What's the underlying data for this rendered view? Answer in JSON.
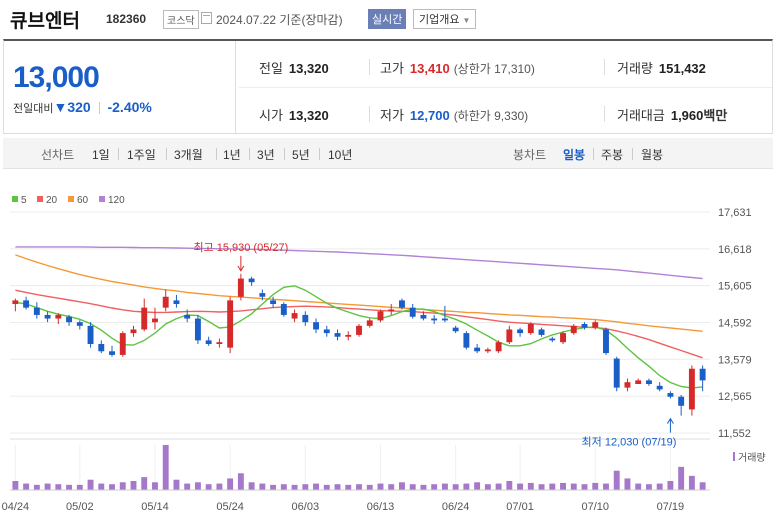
{
  "header": {
    "name": "큐브엔터",
    "code": "182360",
    "market": "코스닥",
    "date": "2024.07.22 기준(장마감)",
    "realtime": "실시간",
    "company_info": "기업개요"
  },
  "quote": {
    "price": "13,000",
    "change_label": "전일대비",
    "change": "320",
    "change_pct": "-2.40%",
    "prev_close": {
      "label": "전일",
      "value": "13,320"
    },
    "open": {
      "label": "시가",
      "value": "13,320"
    },
    "high": {
      "label": "고가",
      "value": "13,410",
      "limit_label": "(상한가 17,310)"
    },
    "low": {
      "label": "저가",
      "value": "12,700",
      "limit_label": "(하한가 9,330)"
    },
    "volume": {
      "label": "거래량",
      "value": "151,432"
    },
    "trading_value": {
      "label": "거래대금",
      "value": "1,960",
      "unit": "백만"
    }
  },
  "periods": {
    "line_label": "선차트",
    "line_items": [
      "1일",
      "1주일",
      "3개월",
      "1년",
      "3년",
      "5년",
      "10년"
    ],
    "candle_label": "봉차트",
    "candle_items": [
      "일봉",
      "주봉",
      "월봉"
    ],
    "candle_selected": "일봉"
  },
  "colors": {
    "up": "#d62a2a",
    "down": "#1a5ec8",
    "ma5": "#5cc43f",
    "ma20": "#f06060",
    "ma60": "#f39a36",
    "ma120": "#b083d6",
    "volume": "#a678c9"
  },
  "chart_data": {
    "type": "candlestick",
    "legend": [
      "5",
      "20",
      "60",
      "120"
    ],
    "y_ticks": [
      17631,
      16618,
      15605,
      14592,
      13579,
      12565,
      11552
    ],
    "ylim": [
      11552,
      17631
    ],
    "x_ticks": [
      "04/24",
      "05/02",
      "05/14",
      "05/24",
      "06/03",
      "06/13",
      "06/24",
      "07/01",
      "07/10",
      "07/19"
    ],
    "x_tick_index": [
      0,
      6,
      13,
      20,
      27,
      34,
      41,
      47,
      54,
      61
    ],
    "annotations": {
      "high": {
        "label": "최고 15,930 (05/27)",
        "index": 21,
        "value": 15930
      },
      "low": {
        "label": "최저 12,030 (07/19)",
        "index": 61,
        "value": 12030
      }
    },
    "volume_label": "거래량",
    "candles": [
      [
        15100,
        15250,
        14900,
        15200
      ],
      [
        15200,
        15300,
        14950,
        15000
      ],
      [
        15000,
        15150,
        14700,
        14800
      ],
      [
        14800,
        14900,
        14600,
        14700
      ],
      [
        14700,
        14850,
        14550,
        14800
      ],
      [
        14750,
        14800,
        14500,
        14600
      ],
      [
        14600,
        14650,
        14400,
        14500
      ],
      [
        14500,
        14600,
        13900,
        14000
      ],
      [
        14000,
        14100,
        13750,
        13800
      ],
      [
        13800,
        13950,
        13650,
        13700
      ],
      [
        13700,
        14350,
        13650,
        14300
      ],
      [
        14300,
        14500,
        14200,
        14400
      ],
      [
        14400,
        15250,
        14350,
        15000
      ],
      [
        14600,
        15000,
        14400,
        14700
      ],
      [
        15000,
        15500,
        14900,
        15300
      ],
      [
        15200,
        15350,
        15000,
        15100
      ],
      [
        14800,
        14950,
        14600,
        14700
      ],
      [
        14700,
        14800,
        14000,
        14100
      ],
      [
        14100,
        14200,
        13950,
        14000
      ],
      [
        14000,
        14150,
        13900,
        14050
      ],
      [
        13900,
        15300,
        13750,
        15200
      ],
      [
        15300,
        15930,
        15200,
        15800
      ],
      [
        15800,
        15850,
        15600,
        15700
      ],
      [
        15400,
        15500,
        15200,
        15300
      ],
      [
        15200,
        15300,
        15000,
        15100
      ],
      [
        15100,
        15150,
        14750,
        14800
      ],
      [
        14700,
        14950,
        14600,
        14850
      ],
      [
        14800,
        14900,
        14500,
        14600
      ],
      [
        14600,
        14700,
        14300,
        14400
      ],
      [
        14400,
        14500,
        14200,
        14300
      ],
      [
        14300,
        14400,
        14100,
        14200
      ],
      [
        14200,
        14350,
        14100,
        14250
      ],
      [
        14250,
        14550,
        14200,
        14500
      ],
      [
        14500,
        14700,
        14450,
        14650
      ],
      [
        14650,
        14950,
        14600,
        14900
      ],
      [
        14900,
        15100,
        14800,
        14950
      ],
      [
        15200,
        15250,
        14950,
        15000
      ],
      [
        15000,
        15100,
        14700,
        14750
      ],
      [
        14800,
        14900,
        14650,
        14700
      ],
      [
        14700,
        14800,
        14550,
        14650
      ],
      [
        14700,
        15050,
        14600,
        14650
      ],
      [
        14450,
        14500,
        14300,
        14350
      ],
      [
        14300,
        14350,
        13850,
        13900
      ],
      [
        13900,
        14000,
        13750,
        13800
      ],
      [
        13800,
        13900,
        13750,
        13850
      ],
      [
        13800,
        14100,
        13750,
        14050
      ],
      [
        14050,
        14500,
        14000,
        14400
      ],
      [
        14400,
        14450,
        14200,
        14300
      ],
      [
        14300,
        14600,
        14250,
        14550
      ],
      [
        14400,
        14450,
        14200,
        14250
      ],
      [
        14150,
        14200,
        14050,
        14100
      ],
      [
        14050,
        14350,
        14000,
        14300
      ],
      [
        14300,
        14550,
        14250,
        14500
      ],
      [
        14550,
        14600,
        14400,
        14450
      ],
      [
        14450,
        14650,
        14400,
        14600
      ],
      [
        14400,
        14450,
        13700,
        13750
      ],
      [
        13600,
        13650,
        12700,
        12800
      ],
      [
        12800,
        13050,
        12700,
        12950
      ],
      [
        12900,
        13050,
        12900,
        13000
      ],
      [
        13000,
        13050,
        12850,
        12900
      ],
      [
        12850,
        12950,
        12700,
        12750
      ],
      [
        12650,
        12700,
        12500,
        12550
      ],
      [
        12550,
        12600,
        12030,
        12300
      ],
      [
        12200,
        13410,
        12030,
        13320
      ],
      [
        13320,
        13410,
        12700,
        13000
      ]
    ],
    "ma5": [
      15150,
      15100,
      15000,
      14900,
      14820,
      14760,
      14680,
      14560,
      14380,
      14160,
      13980,
      13970,
      14100,
      14300,
      14550,
      14700,
      14800,
      14780,
      14620,
      14440,
      14470,
      14640,
      14830,
      15100,
      15360,
      15560,
      15600,
      15480,
      15300,
      15120,
      14980,
      14880,
      14780,
      14720,
      14700,
      14780,
      14890,
      14960,
      14960,
      14890,
      14780,
      14680,
      14550,
      14380,
      14220,
      14050,
      13950,
      13950,
      14010,
      14140,
      14250,
      14330,
      14400,
      14450,
      14470,
      14380,
      14160,
      13880,
      13620,
      13390,
      13130,
      12940,
      12830,
      12790,
      12820
    ],
    "ma20": [
      15480,
      15420,
      15360,
      15310,
      15260,
      15210,
      15160,
      15110,
      15050,
      14990,
      14940,
      14900,
      14880,
      14870,
      14870,
      14880,
      14890,
      14900,
      14890,
      14880,
      14890,
      14910,
      14940,
      14970,
      15000,
      15020,
      15030,
      15040,
      15030,
      15020,
      15000,
      14980,
      14960,
      14940,
      14920,
      14910,
      14900,
      14890,
      14870,
      14850,
      14820,
      14790,
      14750,
      14710,
      14670,
      14630,
      14600,
      14580,
      14560,
      14540,
      14520,
      14500,
      14480,
      14460,
      14450,
      14420,
      14360,
      14290,
      14210,
      14120,
      14020,
      13920,
      13820,
      13720,
      13620
    ],
    "ma60": [
      16450,
      16350,
      16250,
      16160,
      16070,
      15990,
      15910,
      15840,
      15780,
      15720,
      15670,
      15620,
      15570,
      15530,
      15490,
      15460,
      15420,
      15390,
      15360,
      15330,
      15310,
      15290,
      15270,
      15250,
      15230,
      15210,
      15190,
      15170,
      15150,
      15130,
      15110,
      15090,
      15070,
      15050,
      15030,
      15010,
      14990,
      14970,
      14950,
      14930,
      14910,
      14890,
      14870,
      14860,
      14840,
      14820,
      14800,
      14790,
      14770,
      14750,
      14740,
      14720,
      14710,
      14690,
      14670,
      14640,
      14610,
      14570,
      14540,
      14500,
      14470,
      14440,
      14410,
      14380,
      14350
    ],
    "ma120": [
      16670,
      16670,
      16670,
      16670,
      16670,
      16670,
      16670,
      16665,
      16660,
      16660,
      16660,
      16655,
      16650,
      16650,
      16645,
      16640,
      16635,
      16630,
      16625,
      16620,
      16615,
      16610,
      16605,
      16600,
      16590,
      16580,
      16570,
      16560,
      16550,
      16540,
      16530,
      16515,
      16500,
      16485,
      16470,
      16455,
      16440,
      16420,
      16400,
      16380,
      16360,
      16340,
      16320,
      16300,
      16280,
      16260,
      16240,
      16220,
      16200,
      16180,
      16160,
      16140,
      16120,
      16100,
      16080,
      16060,
      16040,
      16010,
      15980,
      15950,
      15920,
      15890,
      15860,
      15830,
      15800
    ],
    "volume": [
      14,
      10,
      8,
      10,
      9,
      8,
      8,
      16,
      10,
      9,
      12,
      14,
      20,
      12,
      70,
      16,
      10,
      12,
      9,
      10,
      18,
      26,
      12,
      10,
      8,
      9,
      8,
      9,
      10,
      8,
      9,
      8,
      9,
      8,
      10,
      9,
      12,
      9,
      8,
      9,
      10,
      9,
      10,
      12,
      9,
      10,
      14,
      10,
      11,
      9,
      10,
      11,
      10,
      9,
      11,
      10,
      30,
      18,
      10,
      9,
      10,
      14,
      36,
      22,
      12
    ]
  }
}
